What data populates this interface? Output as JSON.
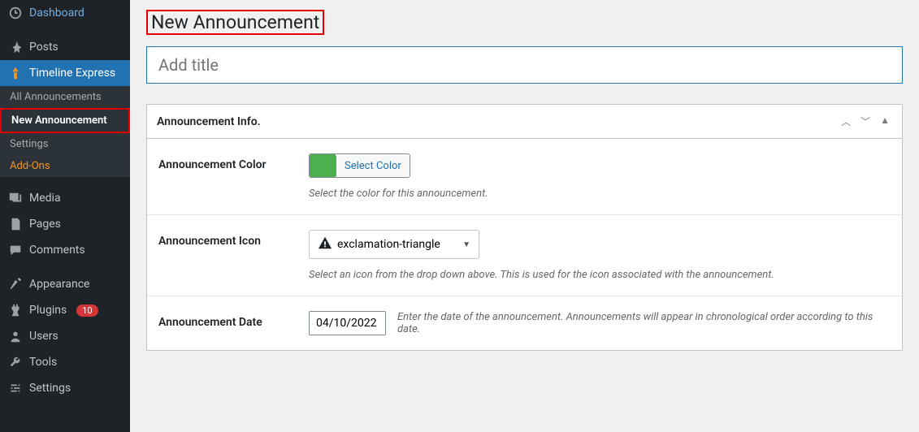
{
  "sidebar": {
    "items": [
      {
        "label": "Dashboard"
      },
      {
        "label": "Posts"
      },
      {
        "label": "Timeline Express"
      },
      {
        "label": "Media"
      },
      {
        "label": "Pages"
      },
      {
        "label": "Comments"
      },
      {
        "label": "Appearance"
      },
      {
        "label": "Plugins"
      },
      {
        "label": "Users"
      },
      {
        "label": "Tools"
      },
      {
        "label": "Settings"
      }
    ],
    "plugins_count": "10",
    "submenu": [
      {
        "label": "All Announcements"
      },
      {
        "label": "New Announcement"
      },
      {
        "label": "Settings"
      },
      {
        "label": "Add-Ons"
      }
    ]
  },
  "main": {
    "page_title": "New Announcement",
    "title_placeholder": "Add title",
    "metabox_title": "Announcement Info.",
    "fields": {
      "color": {
        "label": "Announcement Color",
        "button": "Select Color",
        "help": "Select the color for this announcement."
      },
      "icon": {
        "label": "Announcement Icon",
        "value": "exclamation-triangle",
        "help": "Select an icon from the drop down above. This is used for the icon associated with the announcement."
      },
      "date": {
        "label": "Announcement Date",
        "value": "04/10/2022",
        "help": "Enter the date of the announcement. Announcements will appear in chronological order according to this date."
      }
    }
  }
}
